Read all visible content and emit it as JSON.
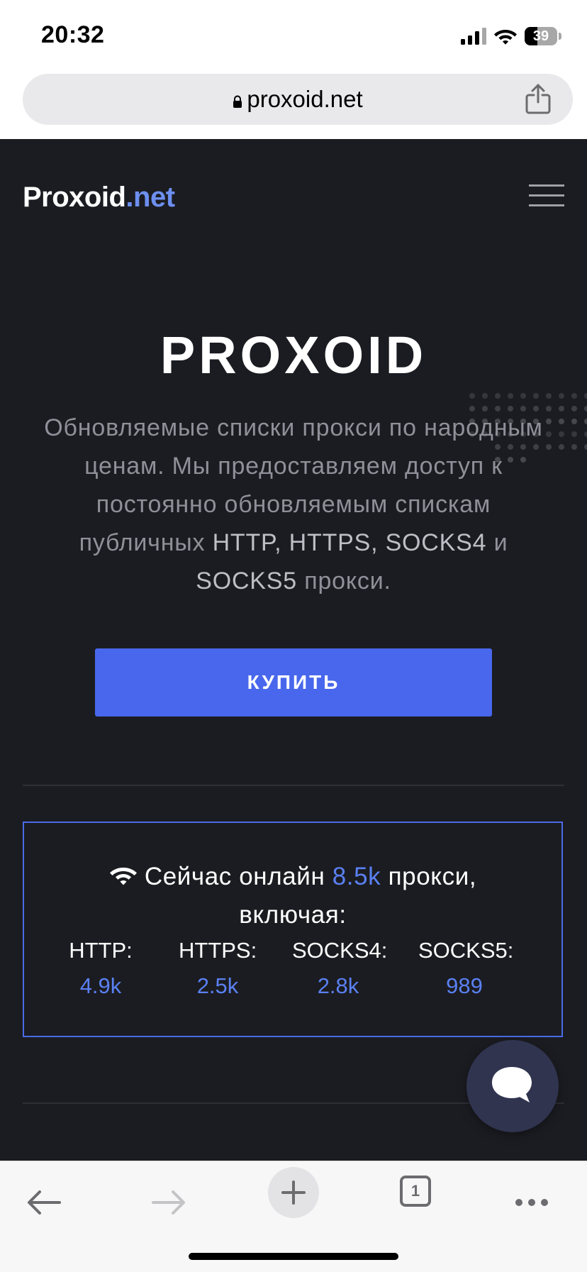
{
  "status_bar": {
    "time": "20:32",
    "battery": "39",
    "battery_level": 0.39
  },
  "browser": {
    "url": "proxoid.net",
    "tab_count": "1"
  },
  "site": {
    "logo_main": "Proxoid",
    "logo_tld": ".net",
    "hero_title": "PROXOID",
    "hero_text": [
      {
        "t": "Обновляемые списки прокси по народным ценам. Мы предоставляем доступ к постоянно обновляемым спискам публичных ",
        "hl": false
      },
      {
        "t": "HTTP, HTTPS, SOCKS4",
        "hl": true
      },
      {
        "t": " и ",
        "hl": false
      },
      {
        "t": "SOCKS5",
        "hl": true
      },
      {
        "t": " прокси.",
        "hl": false
      }
    ],
    "buy_label": "КУПИТЬ",
    "stats": {
      "prefix": "Сейчас онлайн",
      "total": "8.5k",
      "suffix": "прокси,",
      "line2": "включая:",
      "types": [
        {
          "label": "HTTP:",
          "value": "4.9k"
        },
        {
          "label": "HTTPS:",
          "value": "2.5k"
        },
        {
          "label": "SOCKS4:",
          "value": "2.8k"
        },
        {
          "label": "SOCKS5:",
          "value": "989"
        }
      ]
    }
  },
  "colors": {
    "page_bg": "#1b1c21",
    "accent": "#4867ec",
    "link": "#5a80f2",
    "logo_tld": "#6c8ff0"
  },
  "icons": [
    "signal-icon",
    "wifi-icon",
    "battery-icon",
    "lock-icon",
    "share-icon",
    "menu-icon",
    "wifi-icon",
    "chat-icon",
    "back-icon",
    "forward-icon",
    "plus-icon",
    "tabs-icon",
    "more-icon"
  ]
}
